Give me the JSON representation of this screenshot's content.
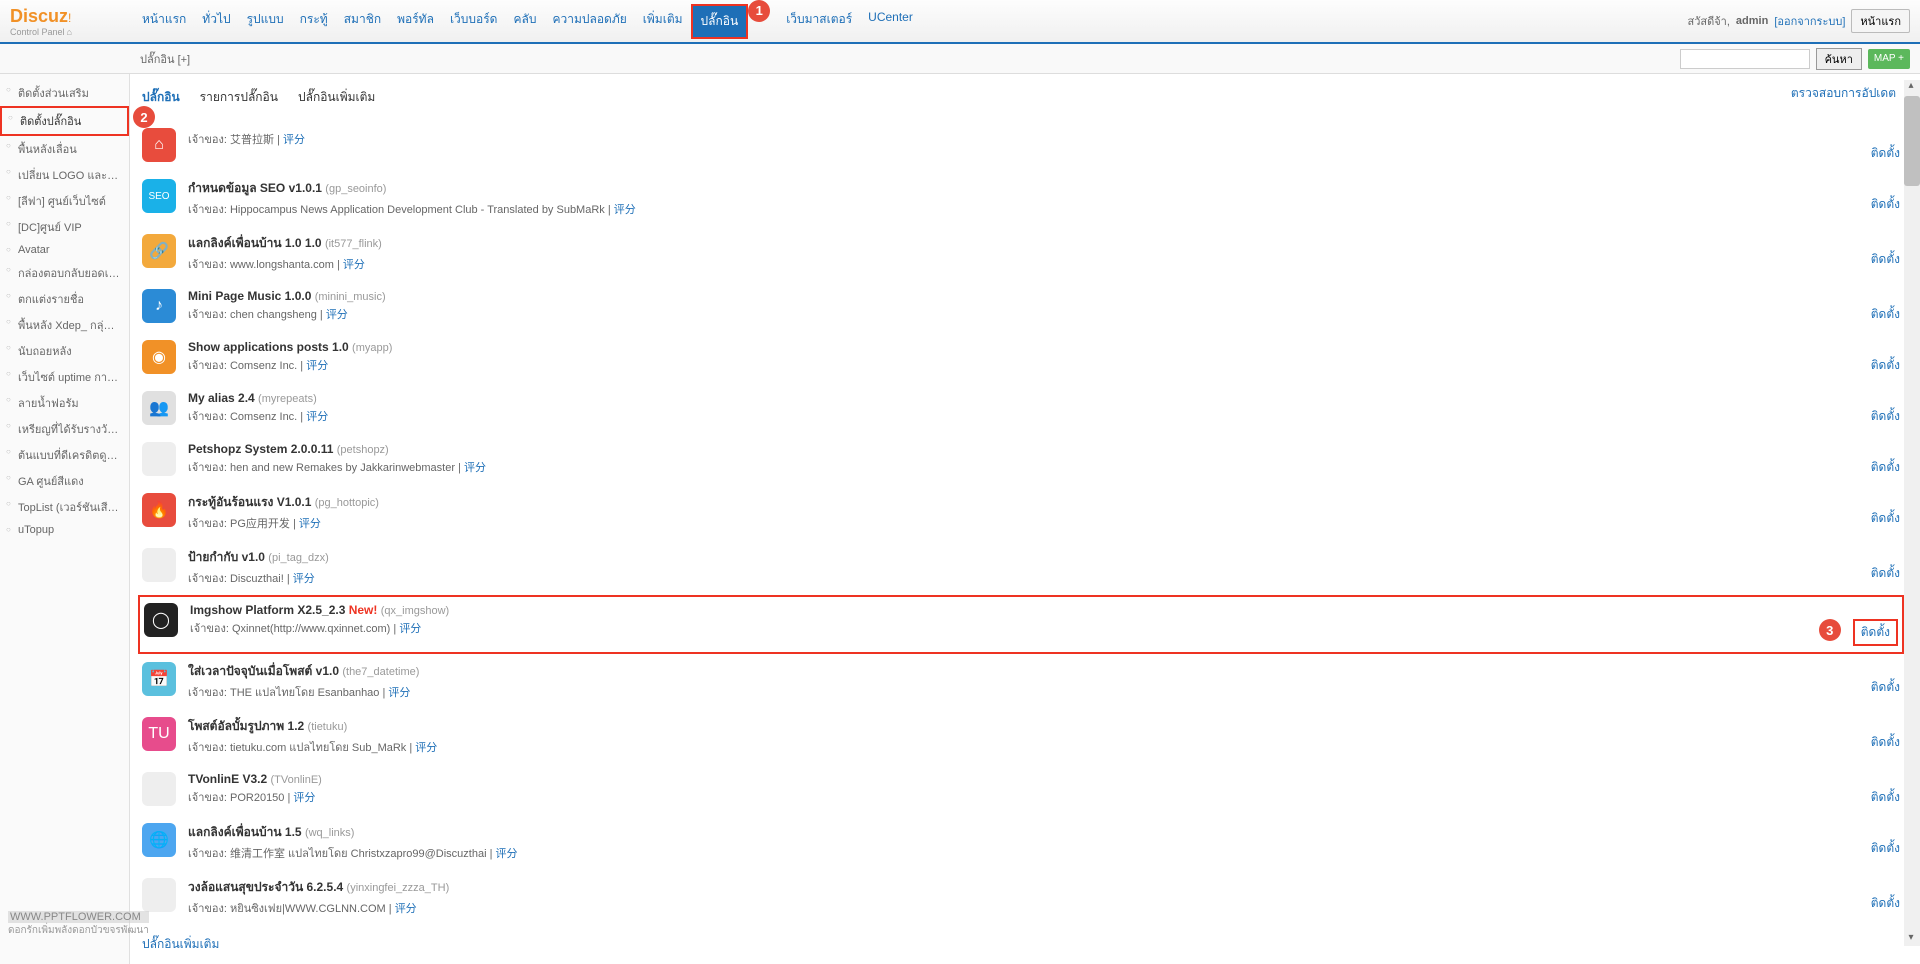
{
  "logo": {
    "main": "Discuz",
    "exclaim": "!",
    "sub": "Control Panel"
  },
  "topnav": [
    "หน้าแรก",
    "ทั่วไป",
    "รูปแบบ",
    "กระทู้",
    "สมาชิก",
    "พอร์ทัล",
    "เว็บบอร์ด",
    "คลับ",
    "ความปลอดภัย",
    "เพิ่มเติม",
    "ปลั๊กอิน",
    "",
    "เว็บมาสเตอร์",
    "UCenter"
  ],
  "topnav_active": 10,
  "topnav_badge": {
    "index": 10,
    "num": "1"
  },
  "user": {
    "greet": "สวัสดีจ้า,",
    "name": "admin",
    "logout": "[ออกจากระบบ]",
    "home": "หน้าแรก"
  },
  "subheader": {
    "left": "ปลั๊กอิน [+]",
    "search": "ค้นหา",
    "map": "MAP +"
  },
  "sidebar": {
    "items": [
      "ติดตั้งส่วนเสริม",
      "ติดตั้งปลั๊กอิน",
      "พื้นหลังเลื่อน",
      "เปลี่ยน LOGO และพื้นหลัง",
      "[ลีฟา] ศูนย์เว็บไซต์",
      "[DC]ศูนย์ VIP",
      "Avatar",
      "กล่องตอบกลับยอดเยี่ยม",
      "ตกแต่งรายชื่อ",
      "พื้นหลัง Xdep_ กลุ่มฟอรัม",
      "นับถอยหลัง",
      "เว็บไซต์ uptime การรักษา",
      "ลายน้ำฟอรัม",
      "เหรียญที่ได้รับรางวัลโดยระ",
      "ต้นแบบที่ดีเครดิตดูเนียม",
      "GA ศูนย์สีแดง",
      "TopList (เวอร์ชันเสียตัว)",
      "uTopup"
    ],
    "active": 1,
    "badge": "2"
  },
  "tabs": {
    "items": [
      "ปลั๊กอิน",
      "รายการปลั๊กอิน",
      "ปลั๊กอินเพิ่มเติม"
    ],
    "active": 0,
    "update": "ตรวจสอบการอัปเดต"
  },
  "plugins": [
    {
      "title": "",
      "sub": "",
      "owner": "艾普拉斯",
      "rate": "评分",
      "color": "#e84c3d",
      "glyph": "⌂",
      "install": "ติดตั้ง",
      "ownlabel": "เจ้าของ:"
    },
    {
      "title": "กำหนดข้อมูล SEO v1.0.1",
      "sub": "(gp_seoinfo)",
      "owner": "Hippocampus News Application Development Club - Translated by SubMaRk",
      "rate": "评分",
      "color": "#1ab1e8",
      "glyph": "SEO",
      "install": "ติดตั้ง",
      "ownlabel": "เจ้าของ:"
    },
    {
      "title": "แลกลิงค์เพื่อนบ้าน 1.0 1.0",
      "sub": "(it577_flink)",
      "owner": "www.longshanta.com",
      "rate": "评分",
      "color": "#f3a93c",
      "glyph": "🔗",
      "install": "ติดตั้ง",
      "ownlabel": "เจ้าของ:"
    },
    {
      "title": "Mini Page Music 1.0.0",
      "sub": "(minini_music)",
      "owner": "chen changsheng",
      "rate": "评分",
      "color": "#2b8bd6",
      "glyph": "♪",
      "install": "ติดตั้ง",
      "ownlabel": "เจ้าของ:"
    },
    {
      "title": "Show applications posts 1.0",
      "sub": "(myapp)",
      "owner": "Comsenz Inc.",
      "rate": "评分",
      "color": "#f19127",
      "glyph": "◉",
      "install": "ติดตั้ง",
      "ownlabel": "เจ้าของ:"
    },
    {
      "title": "My alias 2.4",
      "sub": "(myrepeats)",
      "owner": "Comsenz Inc.",
      "rate": "评分",
      "color": "#e0e0e0",
      "glyph": "👥",
      "install": "ติดตั้ง",
      "ownlabel": "เจ้าของ:"
    },
    {
      "title": "Petshopz System 2.0.0.11",
      "sub": "(petshopz)",
      "owner": "hen and new Remakes by Jakkarinwebmaster",
      "rate": "评分",
      "color": "#eee",
      "glyph": "",
      "install": "ติดตั้ง",
      "ownlabel": "เจ้าของ:"
    },
    {
      "title": "กระทู้อันร้อนแรง V1.0.1",
      "sub": "(pg_hottopic)",
      "owner": "PG应用开发",
      "rate": "评分",
      "color": "#e84c3d",
      "glyph": "🔥",
      "install": "ติดตั้ง",
      "ownlabel": "เจ้าของ:"
    },
    {
      "title": "ป้ายกำกับ v1.0",
      "sub": "(pi_tag_dzx)",
      "owner": "Discuzthai!",
      "rate": "评分",
      "color": "#eee",
      "glyph": "",
      "install": "ติดตั้ง",
      "ownlabel": "เจ้าของ:"
    },
    {
      "title": "Imgshow Platform X2.5_2.3",
      "sub": "(qx_imgshow)",
      "new": "New!",
      "owner": "Qxinnet(http://www.qxinnet.com)",
      "rate": "评分",
      "color": "#222",
      "glyph": "◯",
      "install": "ติดตั้ง",
      "highlight": true,
      "install_box": true,
      "install_badge": "3",
      "ownlabel": "เจ้าของ:"
    },
    {
      "title": "ใส่เวลาปัจจุบันเมื่อโพสต์ v1.0",
      "sub": "(the7_datetime)",
      "owner": "THE แปลไทยโดย Esanbanhao",
      "rate": "评分",
      "color": "#5bc0de",
      "glyph": "📅",
      "install": "ติดตั้ง",
      "ownlabel": "เจ้าของ:"
    },
    {
      "title": "โพสต์อัลบั้มรูปภาพ 1.2",
      "sub": "(tietuku)",
      "owner": "tietuku.com แปลไทยโดย Sub_MaRk",
      "rate": "评分",
      "color": "#e74c8c",
      "glyph": "TU",
      "install": "ติดตั้ง",
      "ownlabel": "เจ้าของ:"
    },
    {
      "title": "TVonlinE V3.2",
      "sub": "(TVonlinE)",
      "owner": "POR20150",
      "rate": "评分",
      "color": "#eee",
      "glyph": "",
      "install": "ติดตั้ง",
      "ownlabel": "เจ้าของ:"
    },
    {
      "title": "แลกลิงค์เพื่อนบ้าน 1.5",
      "sub": "(wq_links)",
      "owner": "维清工作室 แปลไทยโดย Christxzapro99@Discuzthai",
      "rate": "评分",
      "color": "#4da6f0",
      "glyph": "🌐",
      "install": "ติดตั้ง",
      "ownlabel": "เจ้าของ:"
    },
    {
      "title": "วงล้อแสนสุขประจำวัน 6.2.5.4",
      "sub": "(yinxingfei_zzza_TH)",
      "owner": "หยินซิงเฟย|WWW.CGLNN.COM",
      "rate": "评分",
      "color": "#eee",
      "glyph": "",
      "install": "ติดตั้ง",
      "ownlabel": "เจ้าของ:"
    }
  ],
  "more_plugins": "ปลั๊กอินเพิ่มเติม",
  "watermark": {
    "line1": "WWW.PPTFLOWER.COM",
    "line2": "ดอกรักเพิ่มพลังดอกบัวขจรพัฒนา"
  }
}
